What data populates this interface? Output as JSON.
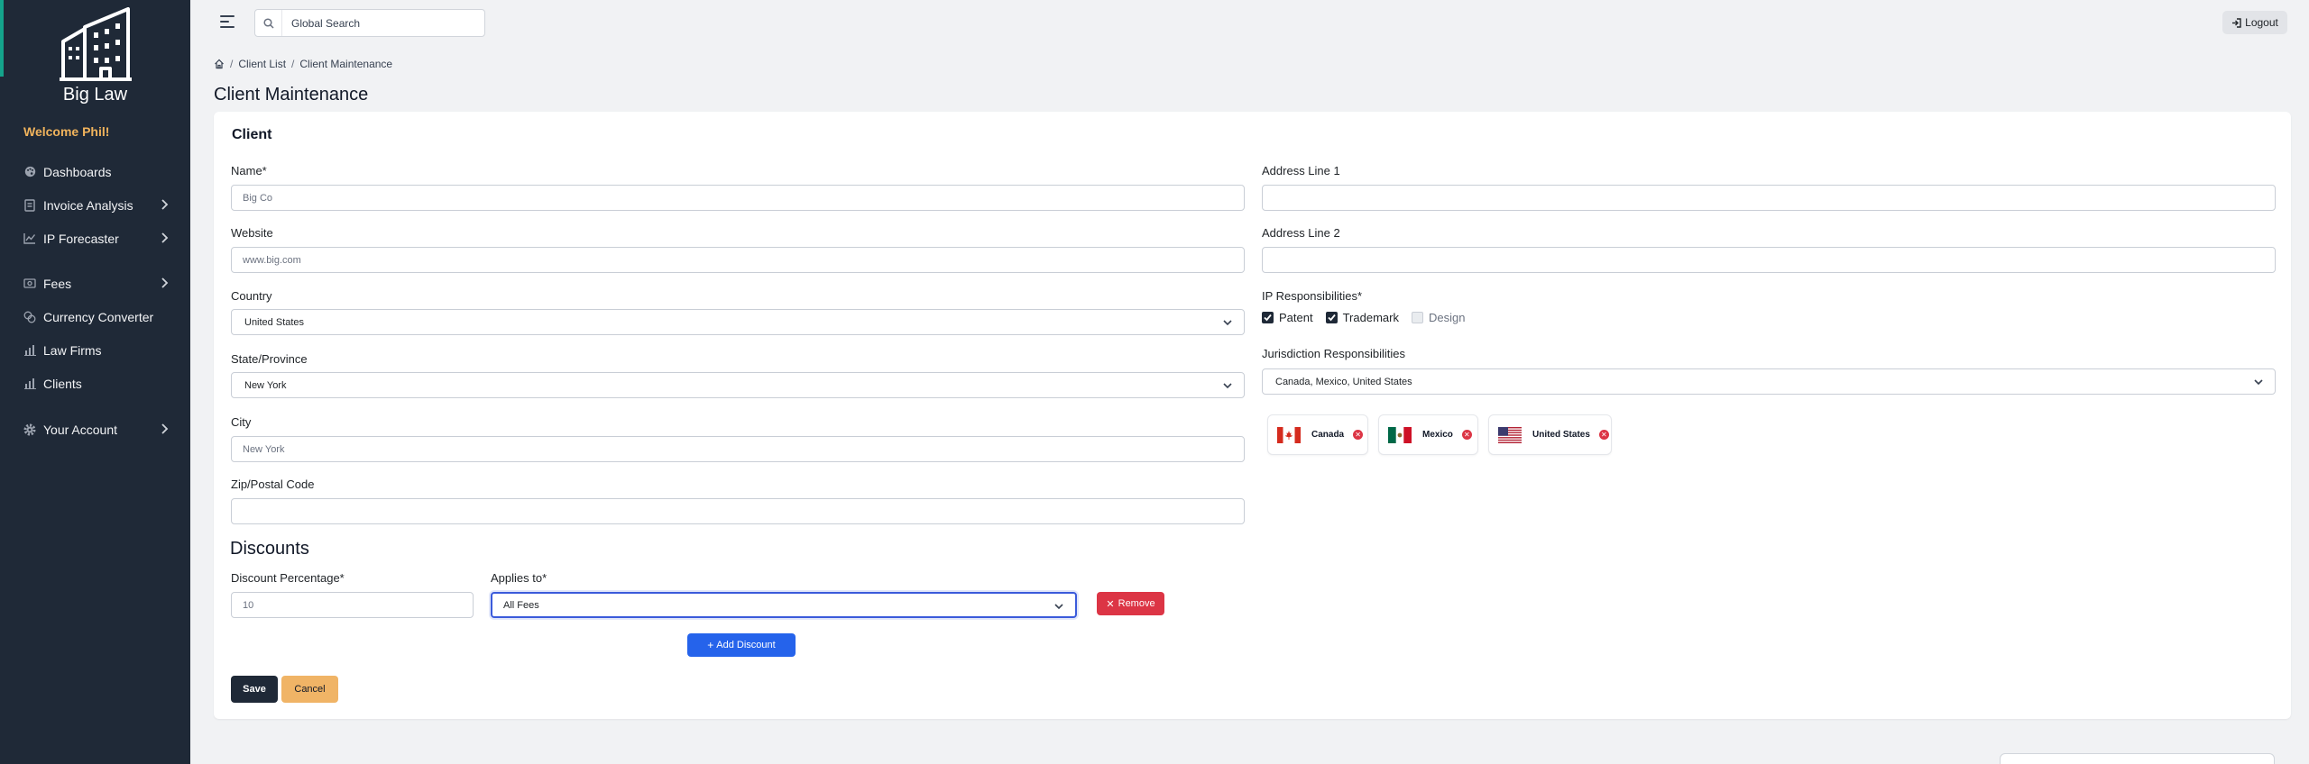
{
  "brand": {
    "name": "Big Law"
  },
  "sidebar": {
    "welcome": "Welcome Phil!",
    "items": [
      {
        "label": "Dashboards",
        "icon": "palette-icon",
        "has_submenu": false
      },
      {
        "label": "Invoice Analysis",
        "icon": "invoice-icon",
        "has_submenu": true
      },
      {
        "label": "IP Forecaster",
        "icon": "chart-line-icon",
        "has_submenu": true
      },
      {
        "label": "Fees",
        "icon": "cash-icon",
        "has_submenu": true
      },
      {
        "label": "Currency Converter",
        "icon": "coins-icon",
        "has_submenu": false
      },
      {
        "label": "Law Firms",
        "icon": "bar-chart-icon",
        "has_submenu": false
      },
      {
        "label": "Clients",
        "icon": "bar-chart-icon",
        "has_submenu": false
      },
      {
        "label": "Your Account",
        "icon": "gear-icon",
        "has_submenu": true
      }
    ]
  },
  "topbar": {
    "search_placeholder": "Global Search",
    "logout_label": "Logout"
  },
  "breadcrumb": {
    "items": [
      "Client List",
      "Client Maintenance"
    ]
  },
  "page": {
    "title": "Client Maintenance"
  },
  "card": {
    "title": "Client"
  },
  "form": {
    "name": {
      "label": "Name*",
      "value": "Big Co"
    },
    "website": {
      "label": "Website",
      "value": "www.big.com"
    },
    "country": {
      "label": "Country",
      "value": "United States"
    },
    "state": {
      "label": "State/Province",
      "value": "New York"
    },
    "city": {
      "label": "City",
      "value": "New York"
    },
    "zip": {
      "label": "Zip/Postal Code",
      "value": ""
    },
    "address1": {
      "label": "Address Line 1",
      "value": ""
    },
    "address2": {
      "label": "Address Line 2",
      "value": ""
    },
    "ip_responsibilities": {
      "label": "IP Responsibilities*",
      "options": [
        {
          "label": "Patent",
          "checked": true
        },
        {
          "label": "Trademark",
          "checked": true
        },
        {
          "label": "Design",
          "checked": false
        }
      ]
    },
    "jurisdiction": {
      "label": "Jurisdiction Responsibilities",
      "value": "Canada, Mexico, United States",
      "chips": [
        "Canada",
        "Mexico",
        "United States"
      ]
    }
  },
  "discounts": {
    "title": "Discounts",
    "percentage_label": "Discount Percentage*",
    "percentage_value": "10",
    "applies_label": "Applies to*",
    "applies_value": "All Fees",
    "remove_label": "Remove",
    "add_label": "Add Discount"
  },
  "actions": {
    "save_label": "Save",
    "cancel_label": "Cancel"
  },
  "colors": {
    "sidebar_bg": "#1f2937",
    "accent_teal": "#14a38b",
    "welcome": "#f0b35c",
    "danger": "#dc3545",
    "primary": "#2563eb",
    "cancel": "#f0b466"
  }
}
